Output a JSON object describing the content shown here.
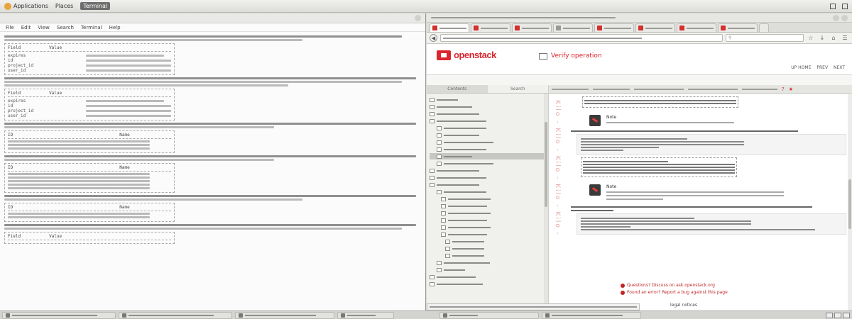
{
  "top_panel": {
    "applications": "Applications",
    "places": "Places",
    "active_app": "Terminal"
  },
  "terminal": {
    "menu": [
      "File",
      "Edit",
      "View",
      "Search",
      "Terminal",
      "Help"
    ],
    "table_header": {
      "field": "Field",
      "value": "Value"
    },
    "table_header_2": {
      "id": "ID",
      "name": "Name"
    },
    "fields": [
      "expires",
      "id",
      "project_id",
      "user_id"
    ]
  },
  "browser": {
    "logo_text": "openstack",
    "doc_title": "Verify operation",
    "pager": [
      "UP HOME",
      "PREV",
      "NEXT"
    ],
    "sidebar_tabs": [
      "Contents",
      "Search"
    ],
    "note_title": "Note",
    "watermark": "Kilo - Kilo - Kilo - Kilo - Kilo -",
    "feedback": [
      "Questions? Discuss on ask.openstack.org",
      "Found an error? Report a bug against this page"
    ],
    "legal": "legal notices"
  },
  "colors": {
    "brand_red": "#d9262f",
    "terminal_bg": "#fbfbfb",
    "panel_bg": "#dcdcd8"
  },
  "icons": [
    "foot-icon",
    "network-icon",
    "volume-icon",
    "book-icon",
    "note-icon",
    "back-icon",
    "forward-icon",
    "home-icon",
    "bookmark-icon",
    "search-icon"
  ]
}
